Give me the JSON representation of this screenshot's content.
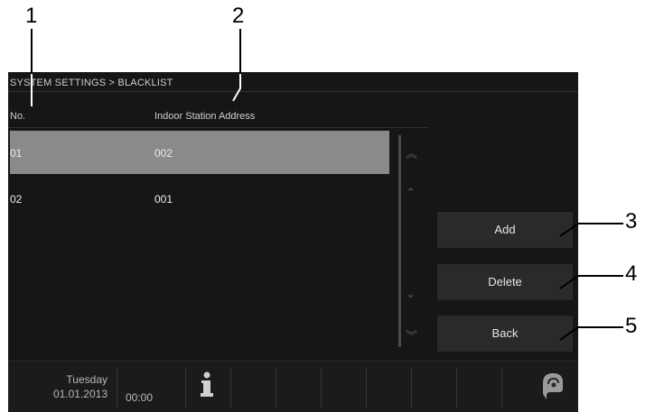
{
  "callouts": [
    "1",
    "2",
    "3",
    "4",
    "5"
  ],
  "header": {
    "breadcrumb": "SYSTEM SETTINGS > BLACKLIST"
  },
  "table": {
    "columns": [
      "No.",
      "Indoor Station Address"
    ],
    "rows": [
      {
        "no": "01",
        "address": "002",
        "selected": true
      },
      {
        "no": "02",
        "address": "001",
        "selected": false
      }
    ]
  },
  "scroll": {
    "icons": [
      "double-chevron-up-icon",
      "chevron-up-icon",
      "chevron-down-icon",
      "double-chevron-down-icon"
    ]
  },
  "buttons": {
    "add": "Add",
    "delete": "Delete",
    "back": "Back"
  },
  "footer": {
    "day": "Tuesday",
    "date": "01.01.2013",
    "time": "00:00",
    "icons": [
      "info-icon",
      "logo-icon"
    ]
  },
  "colors": {
    "screen_bg": "#161616",
    "selected_row": "#8a8a8a",
    "button_bg": "#2a2a2a"
  }
}
